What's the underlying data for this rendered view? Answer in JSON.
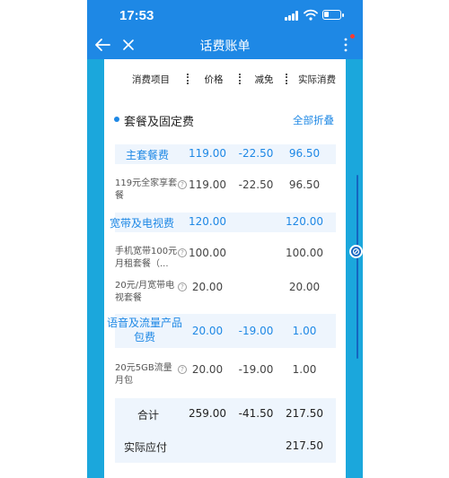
{
  "status_bar": {
    "time": "17:53"
  },
  "nav": {
    "title": "话费账单"
  },
  "columns": {
    "item": "消费项目",
    "price": "价格",
    "discount": "减免",
    "actual": "实际消费"
  },
  "section": {
    "title": "套餐及固定费",
    "toggle": "全部折叠"
  },
  "rows": [
    {
      "type": "category",
      "name": "主套餐费",
      "price": "119.00",
      "discount": "-22.50",
      "actual": "96.50"
    },
    {
      "type": "sub",
      "name": "119元全家享套餐",
      "price": "119.00",
      "discount": "-22.50",
      "actual": "96.50"
    },
    {
      "type": "category",
      "name": "宽带及电视费",
      "price": "120.00",
      "discount": "",
      "actual": "120.00"
    },
    {
      "type": "sub",
      "name": "手机宽带100元月租套餐（...",
      "price": "100.00",
      "discount": "",
      "actual": "100.00"
    },
    {
      "type": "sub",
      "name": "20元/月宽带电视套餐",
      "price": "20.00",
      "discount": "",
      "actual": "20.00"
    },
    {
      "type": "category",
      "name": "语音及流量产品包费",
      "price": "20.00",
      "discount": "-19.00",
      "actual": "1.00"
    },
    {
      "type": "sub",
      "name": "20元5GB流量月包",
      "price": "20.00",
      "discount": "-19.00",
      "actual": "1.00"
    }
  ],
  "total": {
    "label": "合计",
    "price": "259.00",
    "discount": "-41.50",
    "actual": "217.50"
  },
  "payable": {
    "label": "实际应付",
    "actual": "217.50"
  },
  "help_glyph": "?",
  "colors": {
    "accent": "#1e88e5",
    "frame": "#1ba7dc",
    "category_bg": "#eef5fd"
  }
}
